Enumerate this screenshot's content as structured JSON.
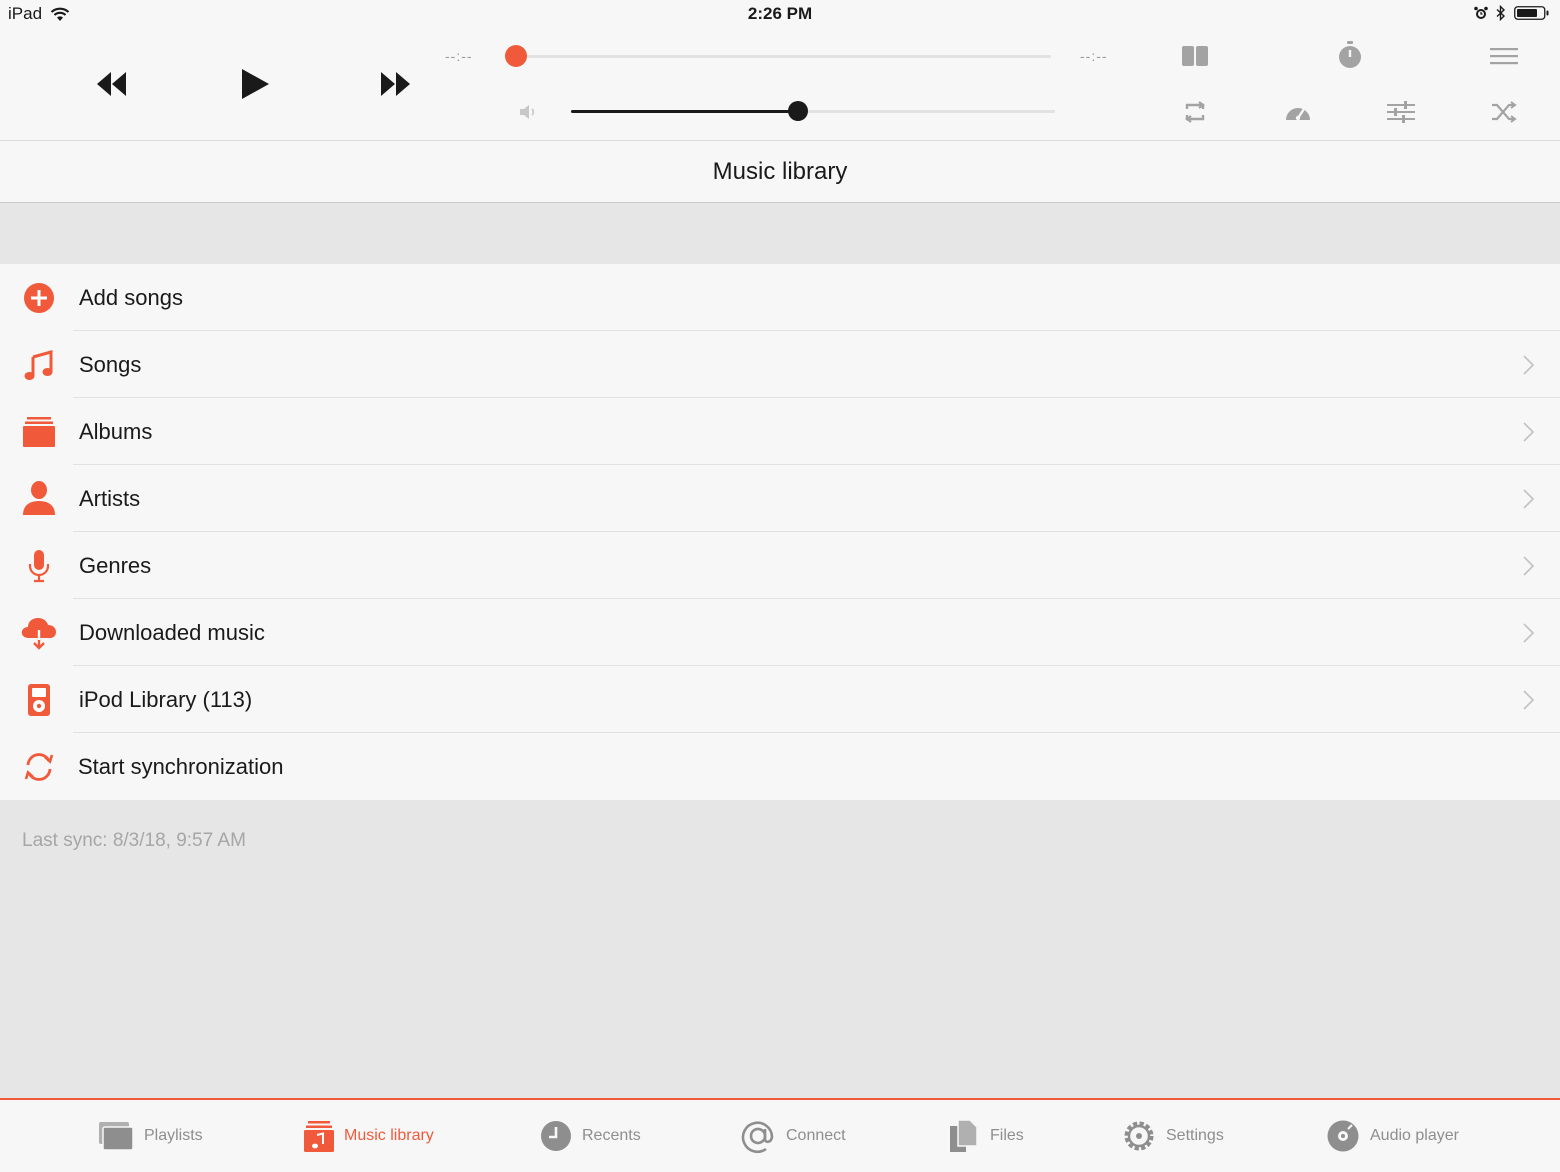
{
  "status_bar": {
    "device": "iPad",
    "time": "2:26 PM"
  },
  "player": {
    "elapsed": "--:--",
    "remaining": "--:--",
    "progress": 0,
    "volume": 0.47
  },
  "header": {
    "title": "Music library"
  },
  "list": {
    "items": [
      {
        "label": "Add songs",
        "icon": "plus-circle-icon",
        "chevron": false
      },
      {
        "label": "Songs",
        "icon": "music-note-icon",
        "chevron": true
      },
      {
        "label": "Albums",
        "icon": "albums-icon",
        "chevron": true
      },
      {
        "label": "Artists",
        "icon": "person-icon",
        "chevron": true
      },
      {
        "label": "Genres",
        "icon": "microphone-icon",
        "chevron": true
      },
      {
        "label": "Downloaded music",
        "icon": "cloud-download-icon",
        "chevron": true
      },
      {
        "label": "iPod Library (113)",
        "icon": "ipod-icon",
        "chevron": true
      },
      {
        "label": "Start synchronization",
        "icon": "sync-icon",
        "chevron": false
      }
    ]
  },
  "footer": {
    "last_sync": "Last sync: 8/3/18, 9:57 AM"
  },
  "tabs": [
    {
      "label": "Playlists",
      "icon": "playlists-icon",
      "active": false
    },
    {
      "label": "Music library",
      "icon": "music-library-icon",
      "active": true
    },
    {
      "label": "Recents",
      "icon": "clock-icon",
      "active": false
    },
    {
      "label": "Connect",
      "icon": "at-icon",
      "active": false
    },
    {
      "label": "Files",
      "icon": "files-icon",
      "active": false
    },
    {
      "label": "Settings",
      "icon": "gear-icon",
      "active": false
    },
    {
      "label": "Audio player",
      "icon": "disc-icon",
      "active": false
    }
  ],
  "colors": {
    "accent": "#f05a3b",
    "icon_gray": "#9a9a9a",
    "text": "#1a1a1a"
  }
}
